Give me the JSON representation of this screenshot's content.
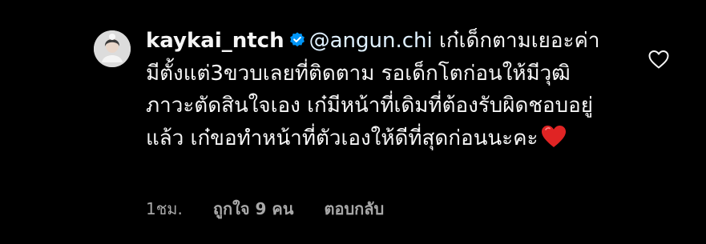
{
  "comment": {
    "username": "kaykai_ntch",
    "verified_icon": "verified-badge-icon",
    "mention": "@angun.chi",
    "text": "เก๋เด็กตามเยอะค่า มีตั้งแต่3ขวบเลยที่ติดตาม รอเด็กโตก่อนให้มีวุฒิภาวะตัดสินใจเอง เก๋มีหน้าที่เดิมที่ต้องรับผิดชอบอยู่แล้ว เก๋ขอทำหน้าที่ตัวเองให้ดีที่สุดก่อนนะคะ",
    "emoji": "red-heart-emoji",
    "time": "1ชม.",
    "likes": "ถูกใจ 9 คน",
    "reply_label": "ตอบกลับ",
    "like_icon": "heart-outline-icon"
  },
  "colors": {
    "background": "#000000",
    "text": "#f5f5f5",
    "mention": "#e0f1ff",
    "meta": "#a8a8a8",
    "verified": "#0095f6",
    "heart": "#ed4956"
  }
}
